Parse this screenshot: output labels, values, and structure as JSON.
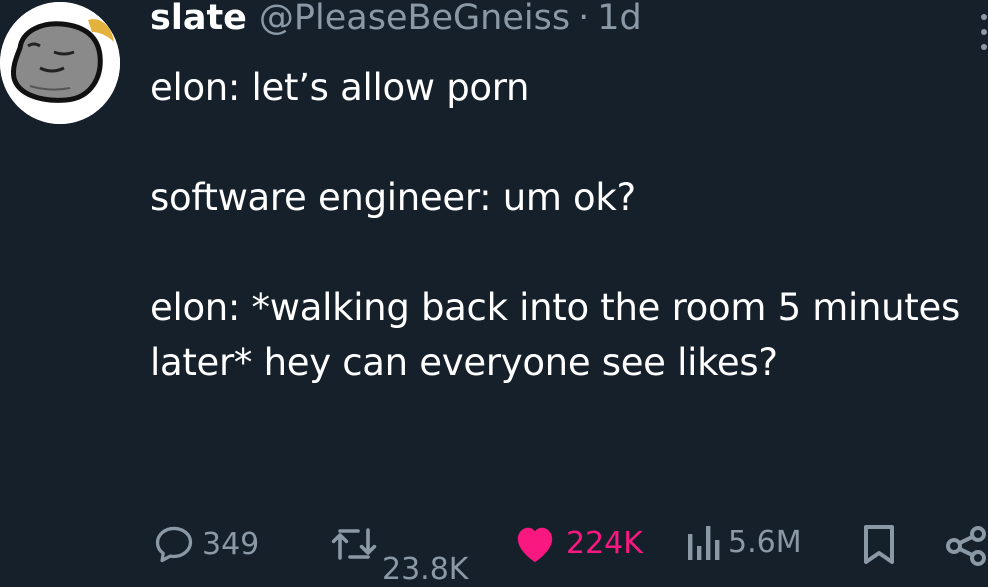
{
  "tweet": {
    "author_name": "slate",
    "handle": "@PleaseBeGneiss",
    "separator": "·",
    "time": "1d",
    "text_lines": [
      "elon: let’s allow porn",
      "software engineer: um ok?",
      "elon: *walking back into the room 5 minutes later* hey can everyone see likes?"
    ]
  },
  "actions": {
    "replies": "349",
    "retweets": "23.8K",
    "likes": "224K",
    "views": "5.6M"
  },
  "colors": {
    "background": "#15202b",
    "text": "#ffffff",
    "secondary": "#8b98a5",
    "like_active": "#f91880"
  },
  "icons": {
    "avatar": "rock-character-avatar",
    "more": "more-vertical-icon",
    "reply": "reply-icon",
    "retweet": "retweet-icon",
    "like": "heart-icon",
    "views": "views-chart-icon",
    "bookmark": "bookmark-icon",
    "share": "share-icon"
  }
}
